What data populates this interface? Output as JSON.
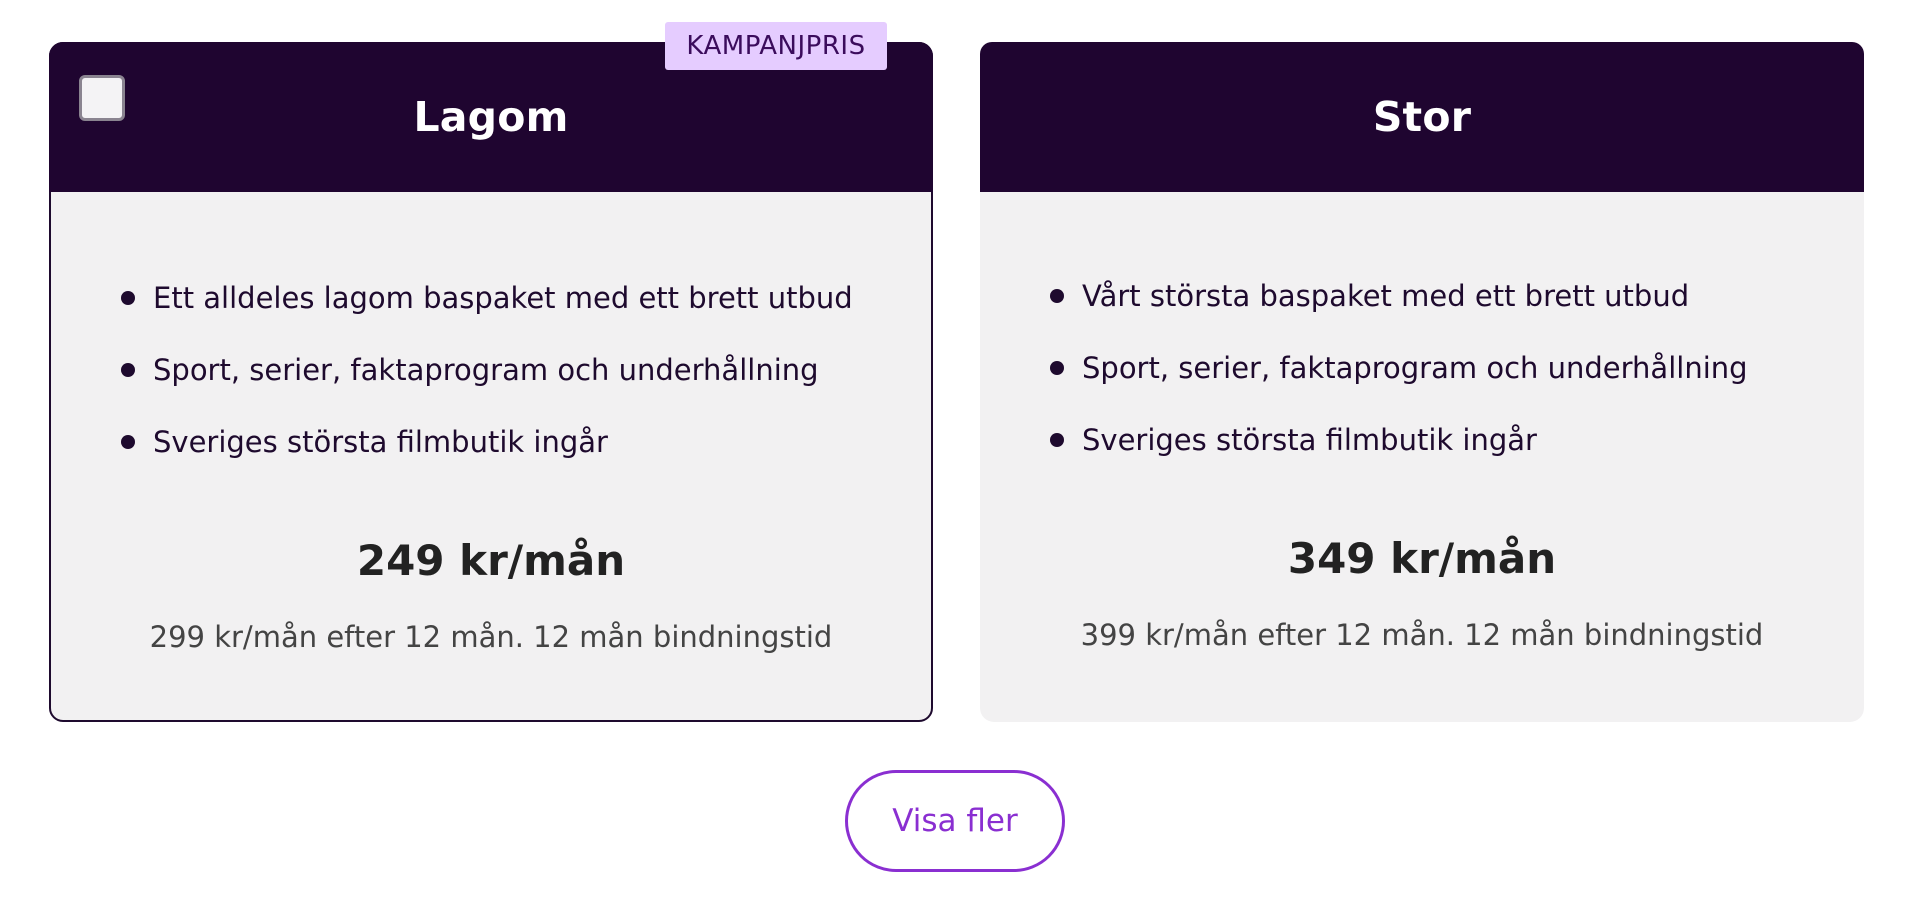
{
  "cards": [
    {
      "title": "Lagom",
      "badge": "KAMPANJPRIS",
      "selected": true,
      "features": [
        "Ett alldeles lagom baspaket med ett brett utbud",
        "Sport, serier, faktaprogram och underhållning",
        "Sveriges största filmbutik ingår"
      ],
      "price": "249 kr/mån",
      "price_note": "299 kr/mån efter 12 mån. 12 mån bindningstid"
    },
    {
      "title": "Stor",
      "features": [
        "Vårt största baspaket med ett brett utbud",
        "Sport, serier, faktaprogram och underhållning",
        "Sveriges största filmbutik ingår"
      ],
      "price": "349 kr/mån",
      "price_note": "399 kr/mån efter 12 mån. 12 mån bindningstid"
    }
  ],
  "more_button": {
    "label": "Visa fler"
  },
  "colors": {
    "header": "#1f0530",
    "card_bg": "#f2f1f2",
    "badge_bg": "#e5ccff",
    "accent": "#8a2fd1"
  }
}
